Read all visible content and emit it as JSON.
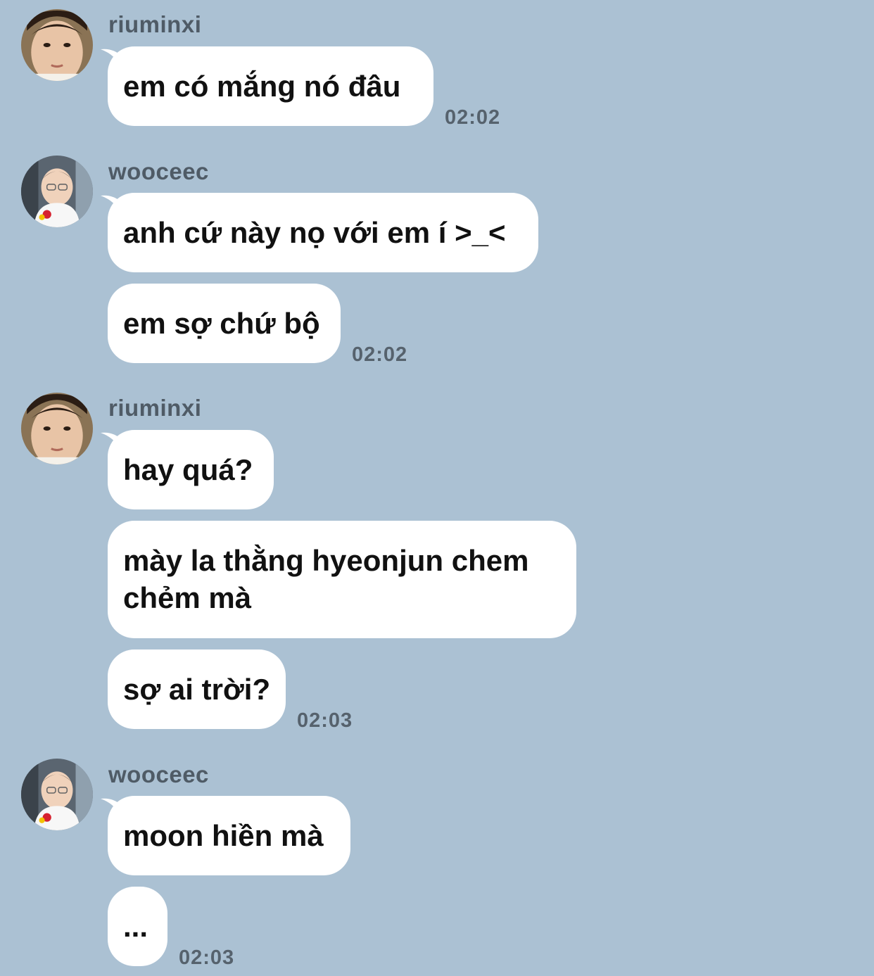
{
  "messages": [
    {
      "sender": "riuminxi",
      "text": "em có mắng nó đâu",
      "time": "02:02"
    },
    {
      "sender": "wooceec",
      "text": "anh cứ này nọ với em í >_<"
    },
    {
      "text": "em sợ chứ bộ",
      "time": "02:02"
    },
    {
      "sender": "riuminxi",
      "text": "hay quá?"
    },
    {
      "text": "mày la thằng hyeonjun chem chẻm mà"
    },
    {
      "text": "sợ ai trời?",
      "time": "02:03"
    },
    {
      "sender": "wooceec",
      "text": "moon hiền mà"
    },
    {
      "text": "...",
      "time": "02:03"
    }
  ]
}
